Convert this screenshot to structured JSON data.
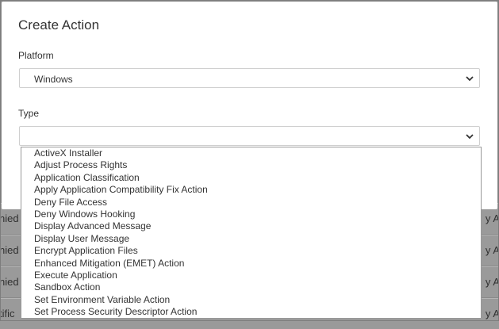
{
  "modal": {
    "title": "Create Action",
    "platform": {
      "label": "Platform",
      "value": "Windows"
    },
    "type": {
      "label": "Type",
      "value": ""
    }
  },
  "dropdown": {
    "options": [
      "ActiveX Installer",
      "Adjust Process Rights",
      "Application Classification",
      "Apply Application Compatibility Fix Action",
      "Deny File Access",
      "Deny Windows Hooking",
      "Display Advanced Message",
      "Display User Message",
      "Encrypt Application Files",
      "Enhanced Mitigation (EMET) Action",
      "Execute Application",
      "Sandbox Action",
      "Set Environment Variable Action",
      "Set Process Security Descriptor Action"
    ]
  },
  "background": {
    "rows": [
      {
        "left": "nied",
        "right": "y A"
      },
      {
        "left": "nied",
        "right": "y A"
      },
      {
        "left": "nied",
        "right": "y A"
      },
      {
        "left": "tific",
        "right": "y A"
      }
    ]
  }
}
